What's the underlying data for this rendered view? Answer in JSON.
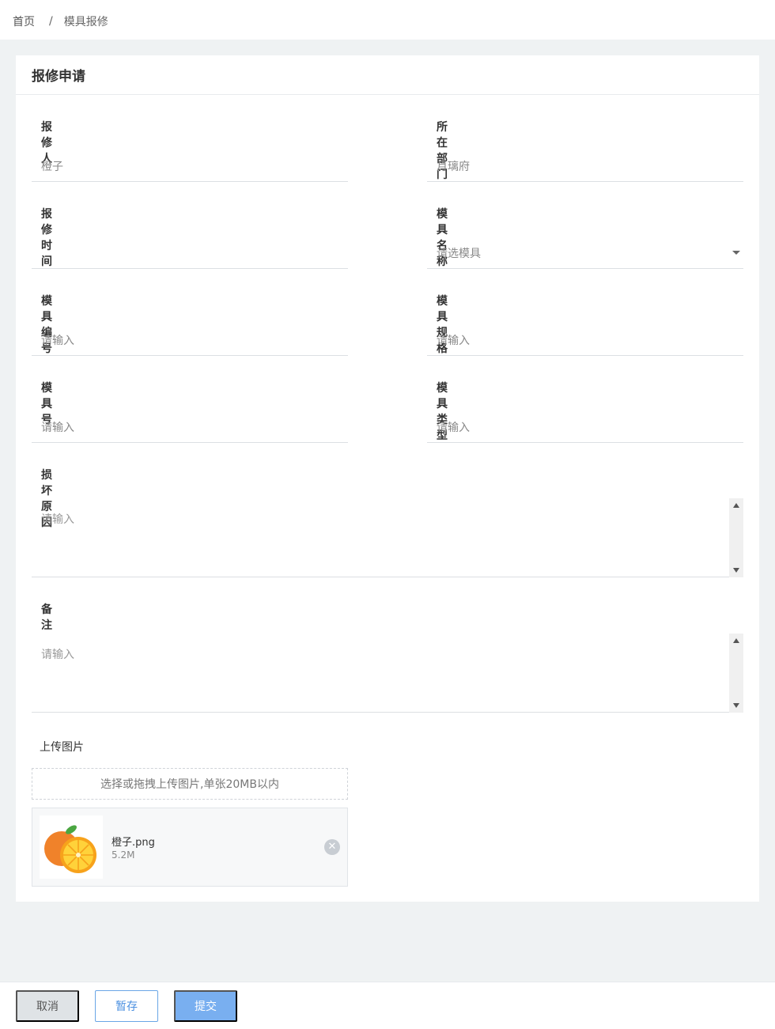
{
  "breadcrumb": {
    "home": "首页",
    "separator": "/",
    "current": "模具报修"
  },
  "card": {
    "title": "报修申请"
  },
  "fields": {
    "reporter": {
      "label": "报修人",
      "value": "橙子"
    },
    "department": {
      "label": "所在部门",
      "value": "月璃府"
    },
    "repair_time": {
      "label": "报修时间",
      "value": ""
    },
    "mold_name": {
      "label": "模具名称",
      "placeholder": "请选模具"
    },
    "mold_number": {
      "label": "模具编号",
      "placeholder": "请输入"
    },
    "mold_spec": {
      "label": "模具规格",
      "placeholder": "请输入"
    },
    "mold_no": {
      "label": "模具号",
      "placeholder": "请输入"
    },
    "mold_type": {
      "label": "模具类型",
      "placeholder": "请输入"
    },
    "damage_reason": {
      "label": "损坏原因",
      "placeholder": "请输入"
    },
    "remark": {
      "label": "备注",
      "placeholder": "请输入"
    }
  },
  "upload": {
    "label": "上传图片",
    "hint": "选择或拖拽上传图片,单张20MB以内",
    "files": [
      {
        "name": "橙子.png",
        "size": "5.2M"
      }
    ]
  },
  "footer": {
    "cancel_label": "取消",
    "save_label": "暂存",
    "submit_label": "提交"
  },
  "colors": {
    "page_bg": "#eff2f3",
    "primary": "#79aff0",
    "primary_border": "#6aa6e6"
  },
  "icons": {
    "select_caret": "caret-down-icon",
    "remove": "close-circle-icon"
  }
}
